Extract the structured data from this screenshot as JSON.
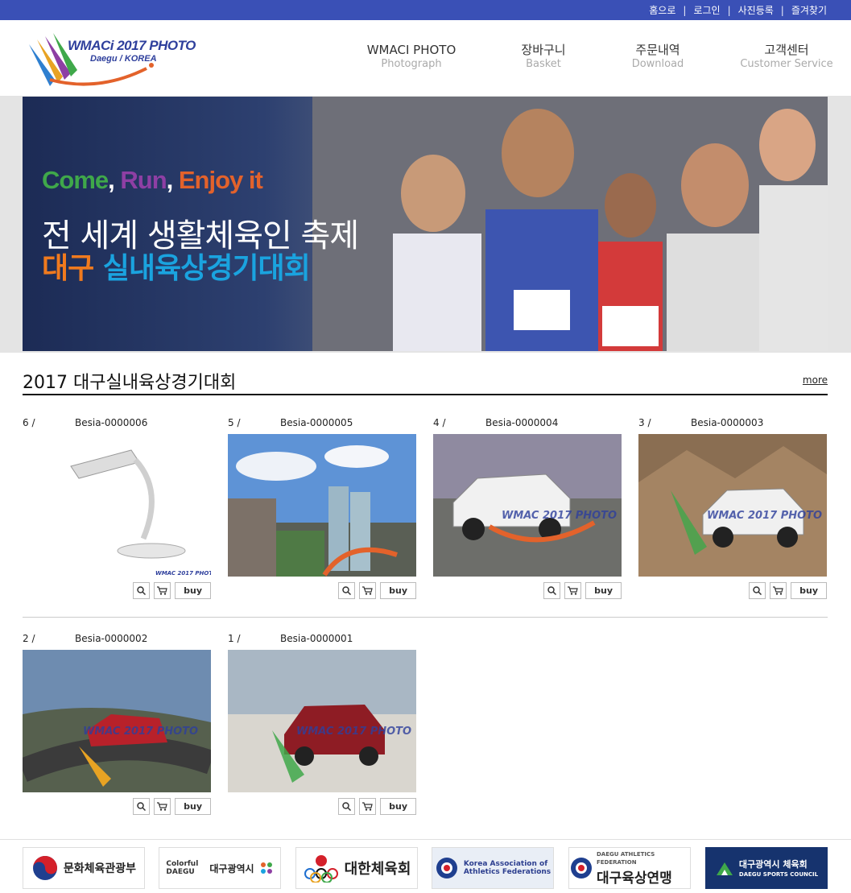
{
  "topbar": {
    "links": [
      "홈으로",
      "로그인",
      "사진등록",
      "즐겨찾기"
    ]
  },
  "logo": {
    "line1": "WMACi 2017 PHOTO",
    "line2": "Daegu / KOREA"
  },
  "nav": [
    {
      "main": "WMACI PHOTO",
      "sub": "Photograph"
    },
    {
      "main": "장바구니",
      "sub": "Basket"
    },
    {
      "main": "주문내역",
      "sub": "Download"
    },
    {
      "main": "고객센터",
      "sub": "Customer Service"
    }
  ],
  "hero": {
    "tag_come": "Come",
    "tag_comma1": ", ",
    "tag_run": "Run",
    "tag_comma2": ", ",
    "tag_enjoy": "Enjoy it",
    "line1": "전 세계 생활체육인 축제",
    "line2_a": "대구",
    "line2_b": " 실내육상경기대회"
  },
  "section": {
    "title": "2017 대구실내육상경기대회",
    "more": "more"
  },
  "cards": [
    {
      "num": "6 /",
      "code": "Besia-0000006",
      "buy": "buy"
    },
    {
      "num": "5 /",
      "code": "Besia-0000005",
      "buy": "buy"
    },
    {
      "num": "4 /",
      "code": "Besia-0000004",
      "buy": "buy"
    },
    {
      "num": "3 /",
      "code": "Besia-0000003",
      "buy": "buy"
    },
    {
      "num": "2 /",
      "code": "Besia-0000002",
      "buy": "buy"
    },
    {
      "num": "1 /",
      "code": "Besia-0000001",
      "buy": "buy"
    }
  ],
  "footer": {
    "logos": [
      {
        "text": "문화체육관광부"
      },
      {
        "text": "대구광역시",
        "small": "Colorful DAEGU"
      },
      {
        "text": "대한체육회"
      },
      {
        "small1": "Korea Association of",
        "small2": "Athletics Federations"
      },
      {
        "text": "대구육상연맹",
        "small": "DAEGU ATHLETICS FEDERATION"
      },
      {
        "text": "대구광역시 체육회",
        "small": "DAEGU SPORTS COUNCIL"
      }
    ]
  },
  "colors": {
    "topbar": "#3a50b6",
    "accent_orange": "#f07a1e",
    "accent_blue": "#1aa3df"
  }
}
